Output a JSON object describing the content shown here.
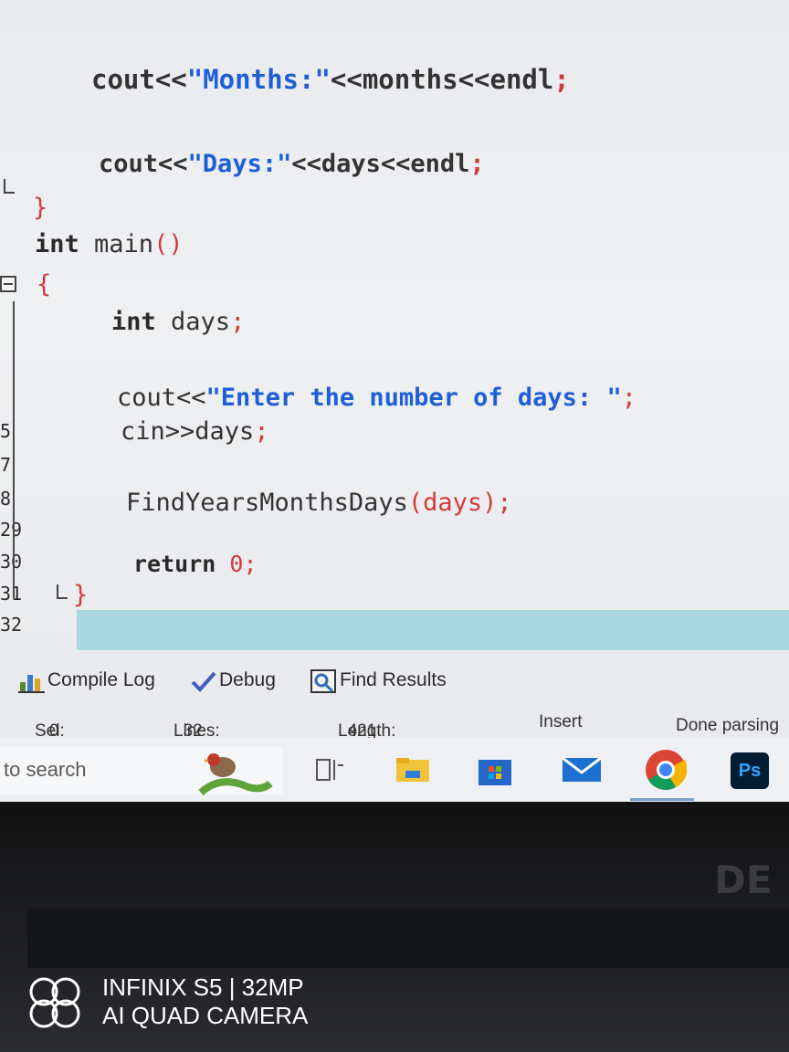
{
  "editor": {
    "line_numbers": [
      "5",
      "7",
      "8",
      "29",
      "30",
      "31",
      "32"
    ],
    "code": {
      "months_prefix": "cout<<",
      "months_string": "\"Months:\"",
      "months_suffix": "<<months<<endl",
      "days_prefix": "cout<<",
      "days_string": "\"Days:\"",
      "days_suffix": "<<days<<endl",
      "close_brace": "}",
      "main_kw": "int",
      "main_name": " main",
      "main_parens": "()",
      "open_brace": "{",
      "decl_kw": "int",
      "decl_rest": " days",
      "prompt_prefix": "cout<<",
      "prompt_string": "\"Enter the number of days: \"",
      "cin_prefix": "cin>>",
      "cin_var": "days",
      "call_name": "FindYearsMonthsDays",
      "call_args": "(days)",
      "return_kw": "return",
      "return_val": "0",
      "end_brace": "}",
      "semicolon": ";"
    }
  },
  "panel_tabs": [
    {
      "label": "Compile Log",
      "icon": "bar-chart-icon"
    },
    {
      "label": "Debug",
      "icon": "checkmark-icon"
    },
    {
      "label": "Find Results",
      "icon": "find-icon"
    }
  ],
  "statusbar": {
    "sel_label": "Sel:",
    "sel_value": "0",
    "lines_label": "Lines:",
    "lines_value": "32",
    "length_label": "Length:",
    "length_value": "421",
    "mode": "Insert",
    "status": "Done parsing"
  },
  "taskbar": {
    "search_placeholder": "to search",
    "icons": [
      "bird-widget-icon",
      "task-view-icon",
      "file-explorer-icon",
      "microsoft-store-icon",
      "mail-icon",
      "chrome-icon",
      "photoshop-icon"
    ],
    "photoshop_label": "Ps"
  },
  "overlay": {
    "brand_logo_text": "DELL",
    "camera_line1": "INFINIX S5 | 32MP",
    "camera_line2": "AI QUAD CAMERA"
  },
  "colors": {
    "string": "#1f5fd6",
    "operator": "#d33b3b",
    "current_line": "#a8d7de"
  }
}
